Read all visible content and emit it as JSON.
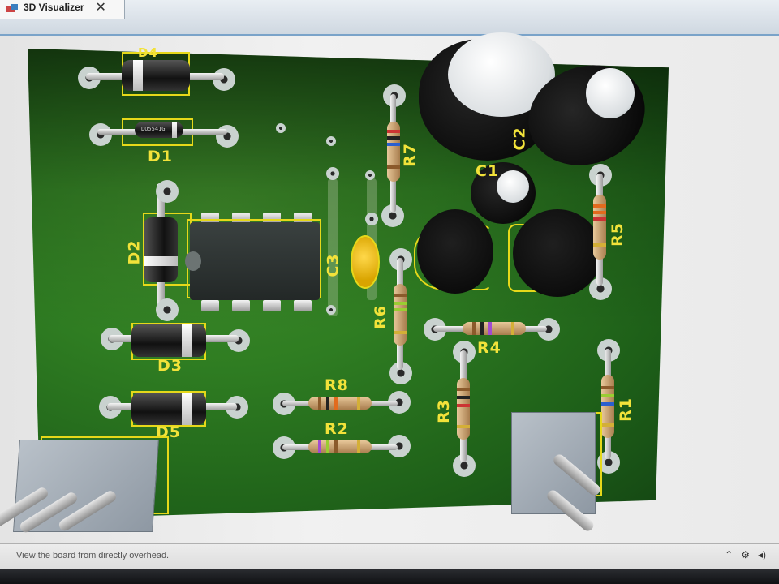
{
  "tab": {
    "label": "3D Visualizer",
    "close": "✕",
    "icon": "visualizer-icon"
  },
  "status": {
    "text": "View the board from directly overhead.",
    "icons": [
      "chevron-up-icon",
      "settings-icon",
      "speaker-icon"
    ]
  },
  "colors": {
    "board": "#2f7d22",
    "silkscreen": "#e6d81a",
    "tab_accent": "#7aa3c9"
  },
  "components": {
    "diodes": [
      "D4",
      "D1",
      "D2",
      "D3",
      "D5"
    ],
    "resistors": [
      "R7",
      "R5",
      "R6",
      "R4",
      "R8",
      "R2",
      "R3",
      "R1"
    ],
    "capacitors": [
      "C2",
      "C1",
      "C3"
    ],
    "d1_marking": "DO5541G"
  }
}
